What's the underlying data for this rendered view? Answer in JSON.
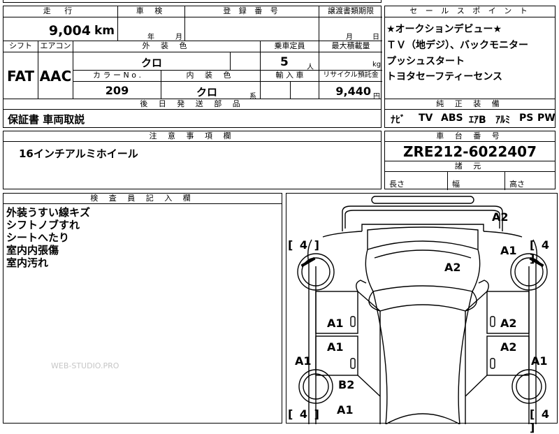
{
  "mileage": {
    "label": "走 行",
    "value": "9,004",
    "unit": "km"
  },
  "inspection": {
    "label": "車 検",
    "year_unit": "年",
    "month_unit": "月"
  },
  "registration": {
    "label": "登 録 番 号"
  },
  "transfer": {
    "label": "譲渡書類期限",
    "month_unit": "月",
    "day_unit": "日"
  },
  "shift": {
    "label": "シフト",
    "value": "FAT"
  },
  "aircon": {
    "label": "エアコン",
    "value": "AAC"
  },
  "exterior_color": {
    "label": "外 装 色",
    "value": "クロ"
  },
  "color_no": {
    "label": "カ ラ ー N o .",
    "value": "209"
  },
  "interior_color": {
    "label": "内 装 色",
    "value": "クロ",
    "suffix": "系"
  },
  "capacity": {
    "label": "乗車定員",
    "value": "5",
    "unit": "人"
  },
  "max_load": {
    "label": "最大積載量",
    "unit": "kg"
  },
  "import": {
    "label": "輸 入 車"
  },
  "recycle": {
    "label": "リサイクル預託金",
    "value": "9,440",
    "unit": "円"
  },
  "later_parts": {
    "label": "後 日 発 送 部 品",
    "value": "保証書 車両取説"
  },
  "sales_points": {
    "label": "セ ー ル ス ポ イ ン ト",
    "lines": [
      "★オークションデビュー★",
      "ＴＶ（地デジ）、バックモニター",
      "プッシュスタート",
      "トヨタセーフティーセンス"
    ]
  },
  "equipment": {
    "label": "純 正 装 備",
    "items": [
      "ﾅﾋﾞ",
      "TV",
      "ABS",
      "ｴｱB",
      "ｱﾙﾐ",
      "PS",
      "PW"
    ]
  },
  "notes": {
    "label": "注 意 事 項 欄",
    "value": "16インチアルミホイール"
  },
  "chassis": {
    "label": "車 台 番 号",
    "value": "ZRE212-6022407"
  },
  "dimensions": {
    "label": "諸 元",
    "length": "長さ",
    "width": "幅",
    "height": "高さ"
  },
  "inspector": {
    "label": "検 査 員 記 入 欄",
    "lines": [
      "外装うすい線キズ",
      "シフトノブすれ",
      "シートへたり",
      "室内内張傷",
      "室内汚れ"
    ]
  },
  "watermark": "WEB-STUDIO.PRO",
  "diagram": {
    "codes": [
      "A2",
      "A1",
      "A2",
      "A1",
      "A2",
      "A1",
      "A2",
      "A1",
      "A1",
      "B2",
      "A1"
    ],
    "tire_marks": [
      "[ 4 ]",
      "[ 4 ]",
      "[ 4 ]",
      "[ 4 ]"
    ]
  }
}
